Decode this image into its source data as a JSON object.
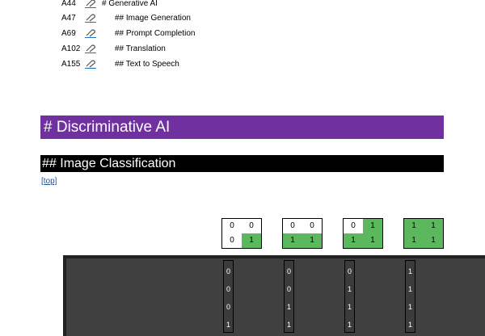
{
  "toc": [
    {
      "ref": "A44",
      "title": "# Generative AI"
    },
    {
      "ref": "A47",
      "title": "## Image Generation"
    },
    {
      "ref": "A69",
      "title": "## Prompt Completion"
    },
    {
      "ref": "A102",
      "title": "## Translation"
    },
    {
      "ref": "A155",
      "title": "## Text to Speech"
    }
  ],
  "heading1": "# Discriminative AI",
  "heading2": "## Image Classification",
  "top_link": "[top]",
  "colors": {
    "heading1_bg": "#7030a0",
    "heading2_bg": "#000000",
    "cell_on": "#5cb85c",
    "panel_bg": "#404040"
  },
  "grids": [
    {
      "cells": [
        "0",
        "0",
        "0",
        "1"
      ],
      "on": [
        false,
        false,
        false,
        true
      ]
    },
    {
      "cells": [
        "0",
        "0",
        "1",
        "1"
      ],
      "on": [
        false,
        false,
        true,
        true
      ]
    },
    {
      "cells": [
        "0",
        "1",
        "1",
        "1"
      ],
      "on": [
        false,
        true,
        true,
        true
      ]
    },
    {
      "cells": [
        "1",
        "1",
        "1",
        "1"
      ],
      "on": [
        true,
        true,
        true,
        true
      ]
    }
  ],
  "columns": [
    [
      "0",
      "0",
      "0",
      "1"
    ],
    [
      "0",
      "0",
      "1",
      "1"
    ],
    [
      "0",
      "1",
      "1",
      "1"
    ],
    [
      "1",
      "1",
      "1",
      "1"
    ]
  ],
  "icon": "hyperlink-icon"
}
